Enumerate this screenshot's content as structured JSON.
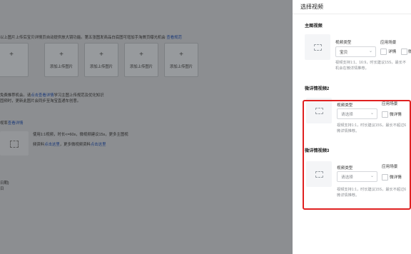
{
  "background": {
    "line1": "以上图片上传后宝贝详情页自动提供放大镜功能。第五张图发商品白底图可增加手淘首页曝光机会",
    "line1_link": "查看规范",
    "upload_label": "添加上传图片",
    "line2_prefix": "免费推荐机会。请",
    "line2_link": "点击查看详情",
    "line2_suffix": "学习主图上传规范及优化知识",
    "line3": "固频时，更新此图片会同步至淘宝直通车创意。",
    "line4_prefix": "视率",
    "line4_link": "查看详情",
    "line5": "使用1:1视频，时长<=60s，微视频建议15s，更多主图视",
    "line6_prefix": "频资料",
    "line6_link1": "点击这里",
    "line6_mid": "，更多微视频资料",
    "line6_link2": "点击这里",
    "line7": "日期)",
    "line8": "日"
  },
  "drawer": {
    "title": "选择视频",
    "main_video": {
      "title": "主图视频",
      "type_label": "视频类型",
      "type_value": "宝贝",
      "scene_label": "应用场景",
      "scene_option1": "详情",
      "scene_option2": "微",
      "help_line1": "视频支持1:1、16:9，时长建议15S，最长不",
      "help_line2": "机会在微详情推荐。"
    },
    "micro_video2": {
      "title": "微详情视频2",
      "type_label": "视频类型",
      "type_placeholder": "请选择",
      "scene_label": "应用场景",
      "scene_option": "微详情",
      "help_line1": "视频支持1:1，时长建议15S，最长不超过6",
      "help_line2": "微详情推荐。"
    },
    "micro_video3": {
      "title": "微详情视频3",
      "type_label": "视频类型",
      "type_placeholder": "请选择",
      "scene_label": "应用场景",
      "scene_option": "微详情",
      "help_line1": "视频支持1:1，时长建议15S，最长不超过6",
      "help_line2": "微详情推荐。"
    }
  },
  "colors": {
    "highlight": "#e02020",
    "overlay": "#8c8e91",
    "link": "#1b3a78"
  }
}
